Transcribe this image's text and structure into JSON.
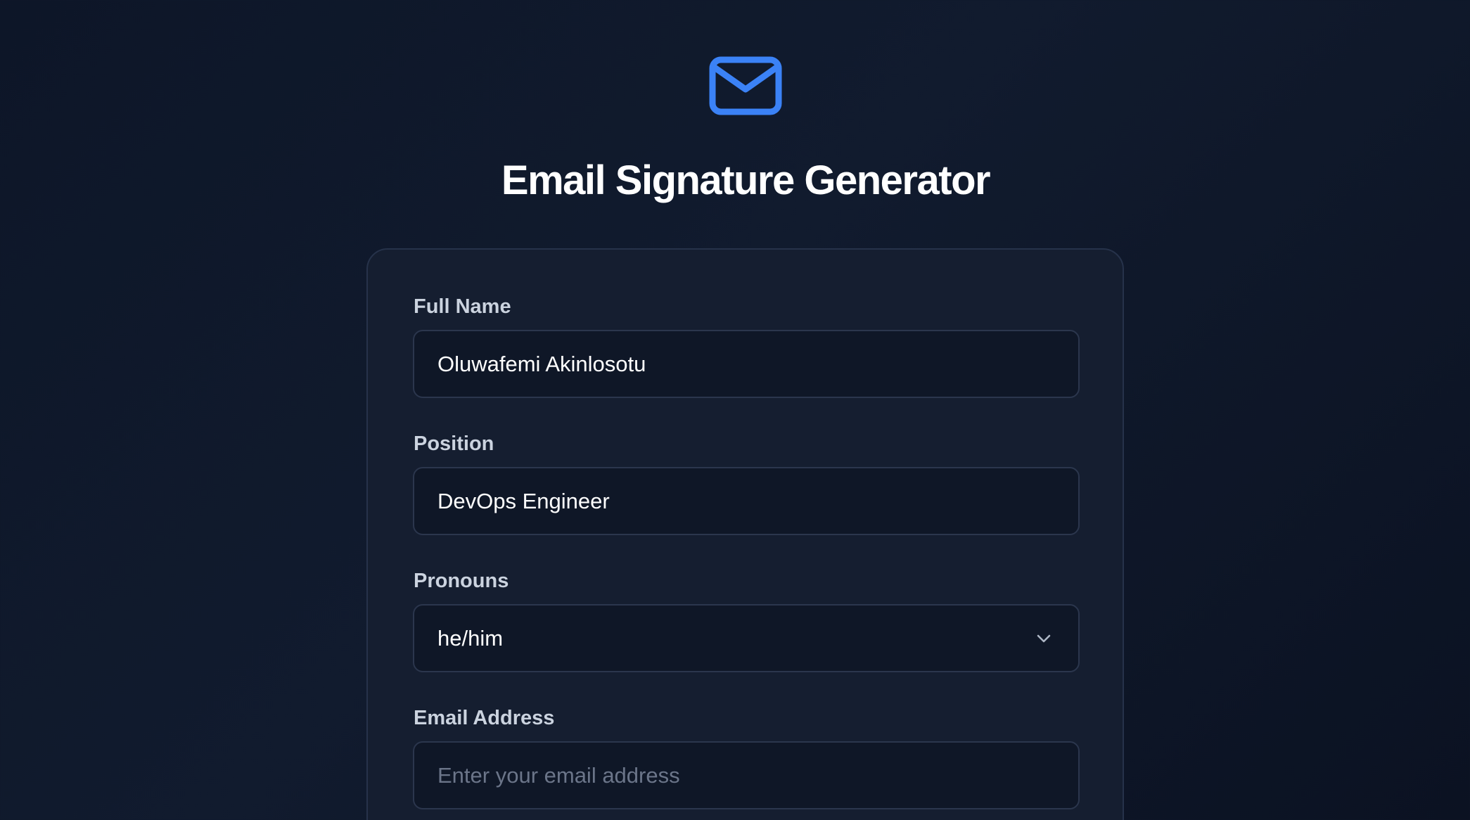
{
  "app": {
    "title": "Email Signature Generator",
    "logo_icon": "mail-icon",
    "accent_color": "#3b82f6"
  },
  "form": {
    "full_name": {
      "label": "Full Name",
      "value": "Oluwafemi Akinlosotu"
    },
    "position": {
      "label": "Position",
      "value": "DevOps Engineer"
    },
    "pronouns": {
      "label": "Pronouns",
      "selected": "he/him",
      "icon": "chevron-down-icon"
    },
    "email": {
      "label": "Email Address",
      "value": "",
      "placeholder": "Enter your email address"
    }
  }
}
